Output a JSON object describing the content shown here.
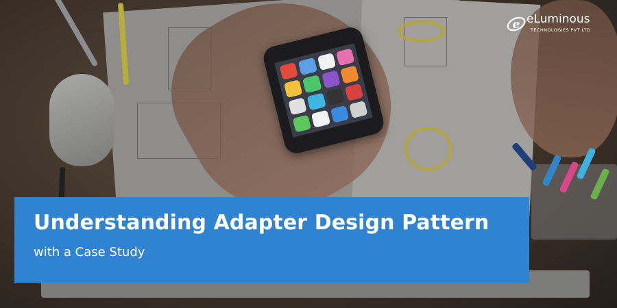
{
  "brand": {
    "name": "eLuminous",
    "tagline": "TECHNOLOGIES PVT LTD",
    "mark_letter": "e"
  },
  "banner": {
    "title": "Understanding Adapter Design Pattern",
    "subtitle": "with a Case Study",
    "color": "#2f83d0"
  },
  "photo": {
    "description_icon": "desk-photo-icon"
  }
}
